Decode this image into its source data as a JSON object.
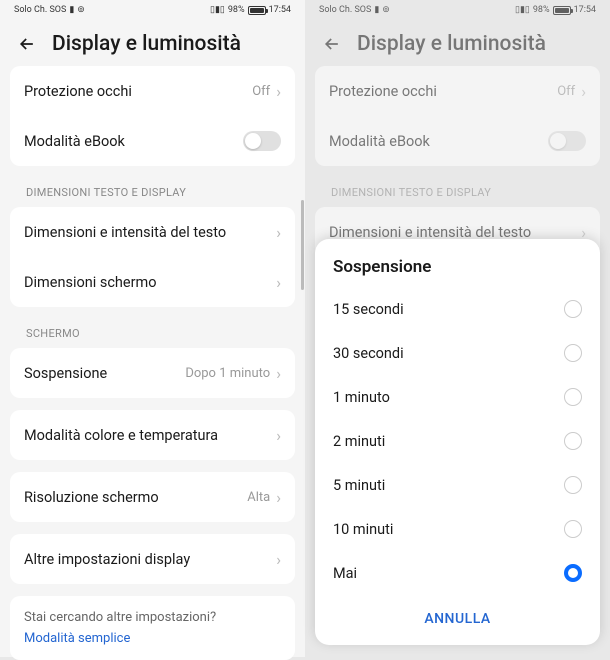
{
  "statusbar": {
    "carrier": "Solo Ch. SOS",
    "battery": "98%",
    "time": "17:54"
  },
  "header": {
    "title": "Display e luminosità"
  },
  "rows": {
    "eye": {
      "label": "Protezione occhi",
      "value": "Off"
    },
    "ebook": {
      "label": "Modalità eBook"
    },
    "textsize": {
      "label": "Dimensioni e intensità del testo"
    },
    "screensize": {
      "label": "Dimensioni schermo"
    },
    "sleep": {
      "label": "Sospensione",
      "value": "Dopo 1 minuto"
    },
    "colortemp": {
      "label": "Modalità colore e temperatura"
    },
    "resolution": {
      "label": "Risoluzione schermo",
      "value": "Alta"
    },
    "more": {
      "label": "Altre impostazioni display"
    }
  },
  "sections": {
    "text": "DIMENSIONI TESTO E DISPLAY",
    "screen": "SCHERMO"
  },
  "footer": {
    "question": "Stai cercando altre impostazioni?",
    "link": "Modalità semplice"
  },
  "sheet": {
    "title": "Sospensione",
    "options": [
      "15 secondi",
      "30 secondi",
      "1 minuto",
      "2 minuti",
      "5 minuti",
      "10 minuti",
      "Mai"
    ],
    "selected": "Mai",
    "cancel": "ANNULLA"
  }
}
